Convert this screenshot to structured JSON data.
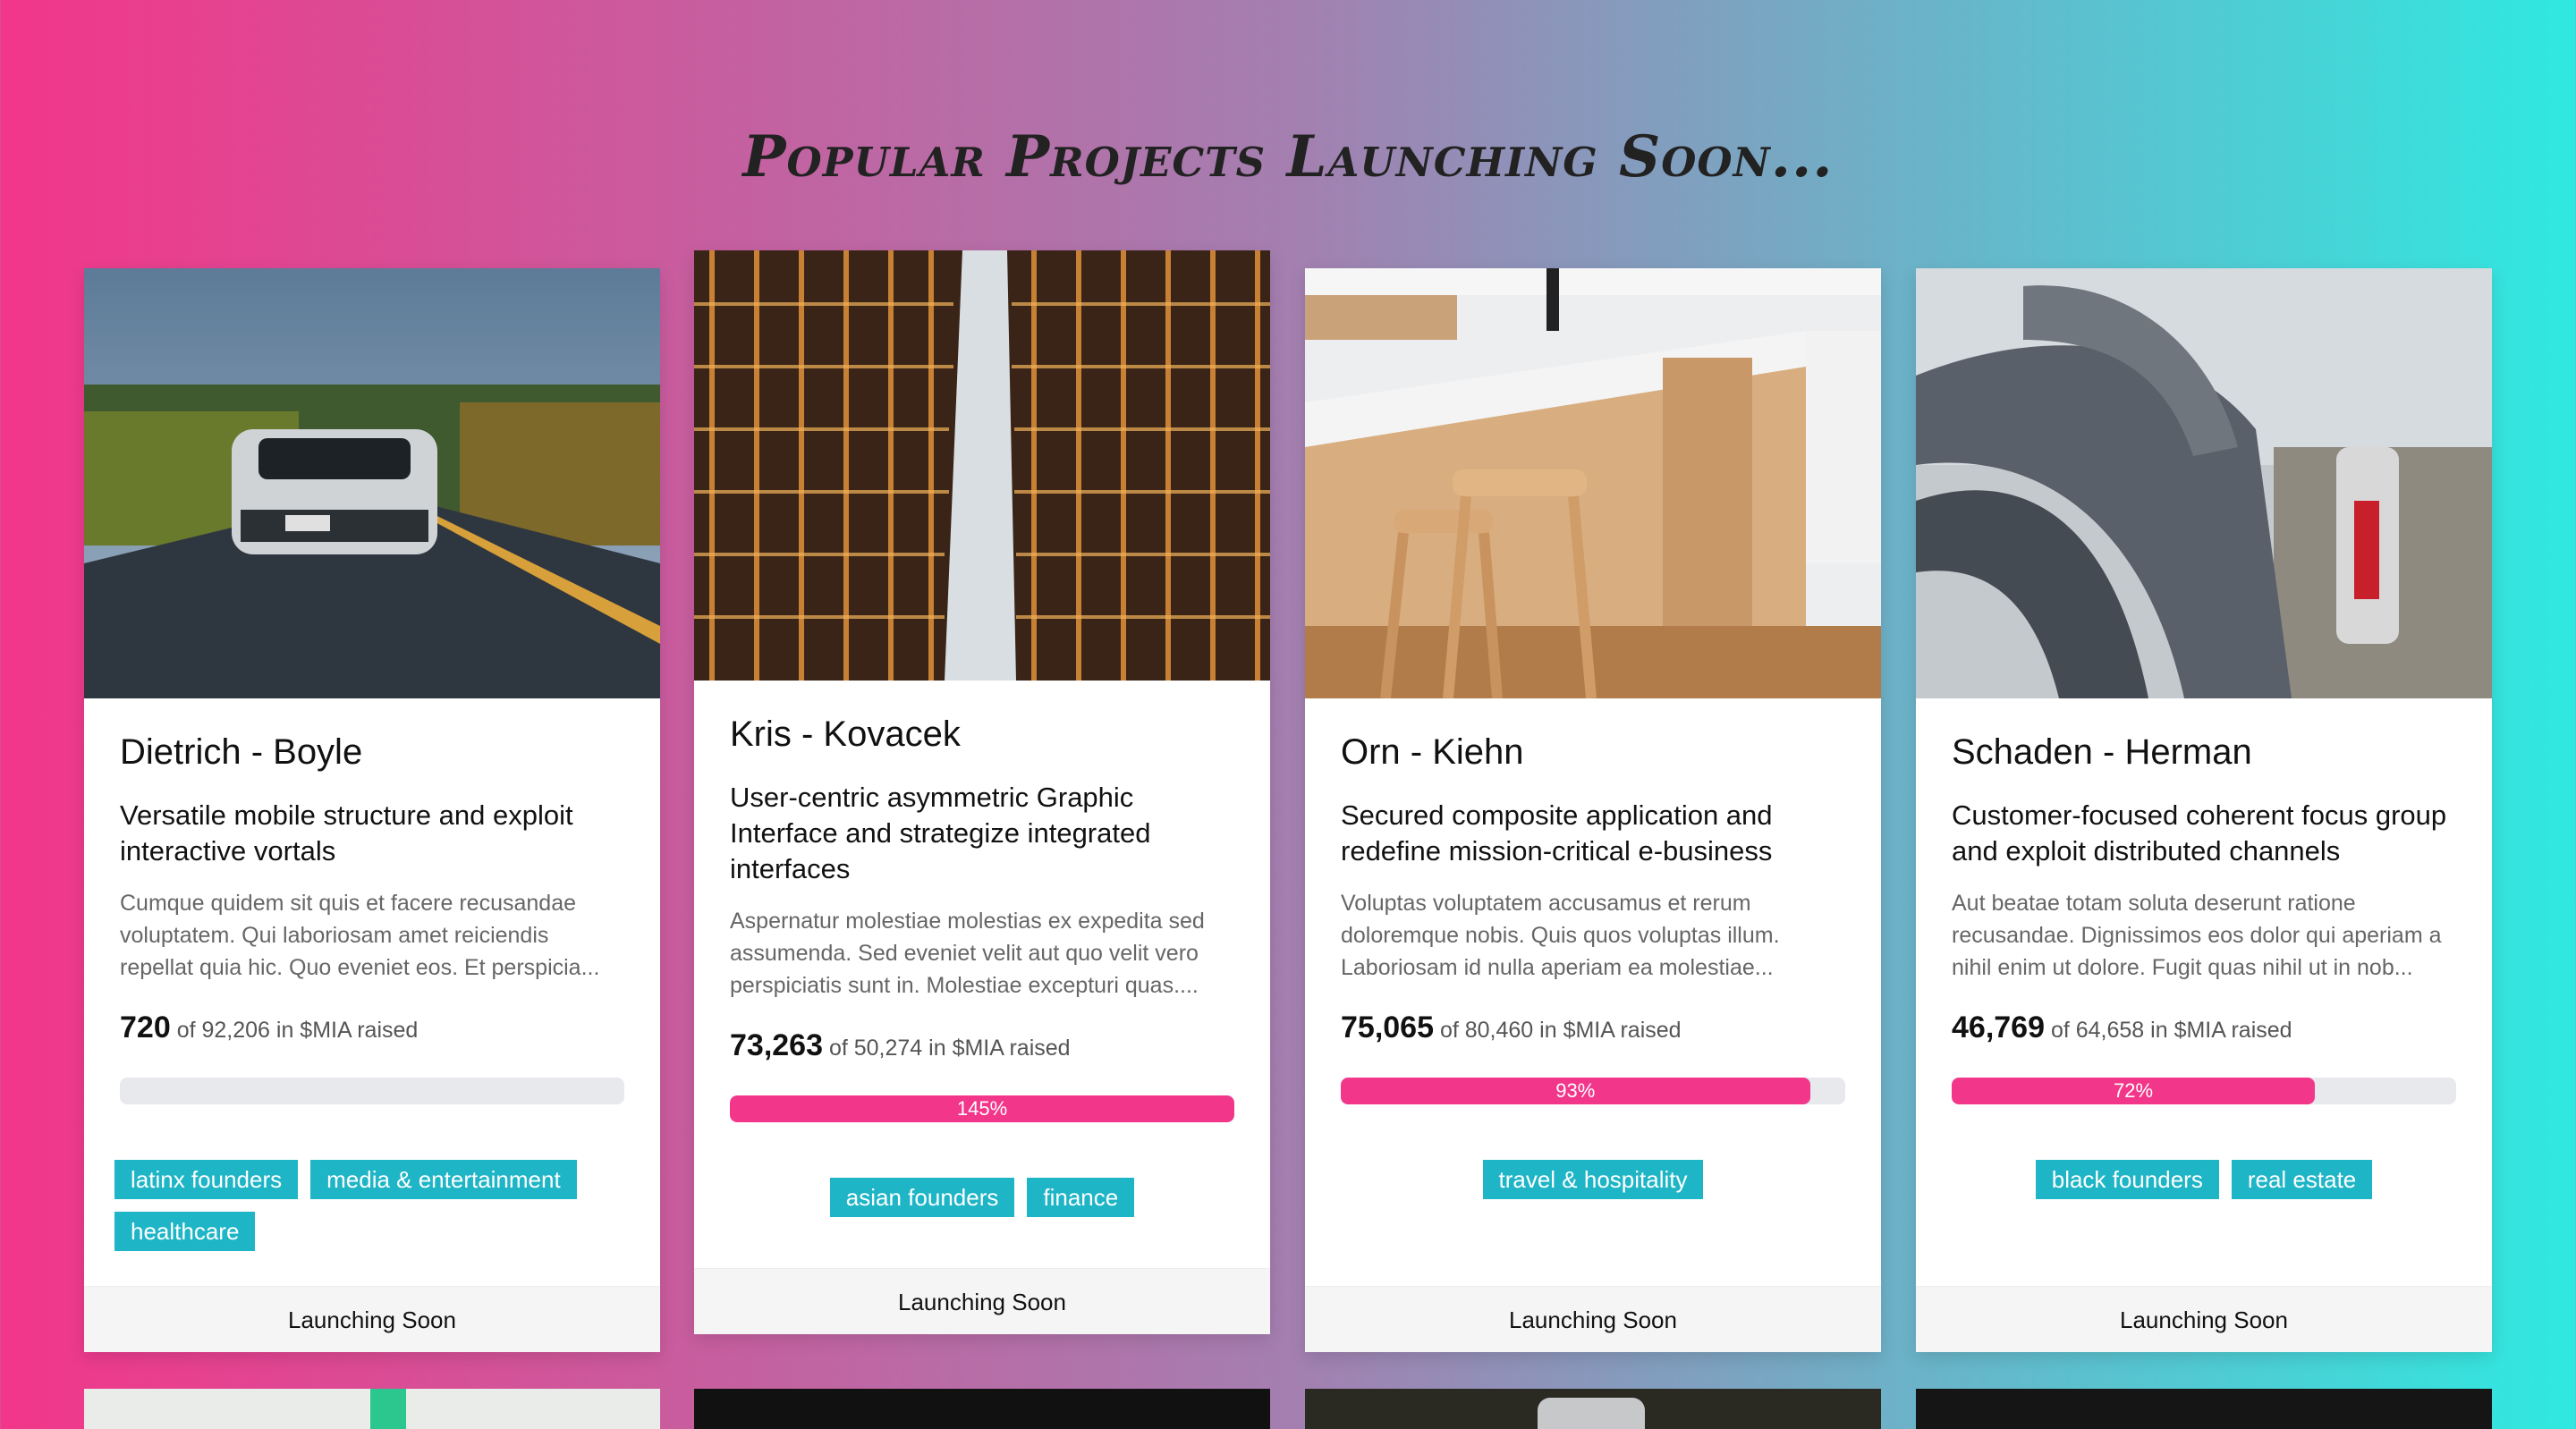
{
  "page": {
    "title": "Popular Projects Launching Soon..."
  },
  "colors": {
    "accent_pink": "#f2368a",
    "tag_teal": "#1eb5c6",
    "gradient_start": "#f2368a",
    "gradient_end": "#2fe9e1"
  },
  "cards": [
    {
      "name": "Dietrich - Boyle",
      "headline": "Versatile mobile structure and exploit interactive vortals",
      "description": "Cumque quidem sit quis et facere recusandae voluptatem. Qui laboriosam amet reiciendis repellat quia hic. Quo eveniet eos. Et perspicia...",
      "raised_amount": "720",
      "raised_text": "of 92,206 in $MIA raised",
      "progress_percent": 0,
      "progress_label": "",
      "tags": [
        "latinx founders",
        "media & entertainment",
        "healthcare"
      ],
      "footer": "Launching Soon",
      "image": "car-on-road-photo"
    },
    {
      "name": "Kris - Kovacek",
      "headline": "User-centric asymmetric Graphic Interface and strategize integrated interfaces",
      "description": "Aspernatur molestiae molestias ex expedita sed assumenda. Sed eveniet velit aut quo velit vero perspiciatis sunt in. Molestiae excepturi quas....",
      "raised_amount": "73,263",
      "raised_text": "of 50,274 in $MIA raised",
      "progress_percent": 145,
      "progress_label": "145%",
      "tags": [
        "asian founders",
        "finance"
      ],
      "footer": "Launching Soon",
      "image": "skyscrapers-photo"
    },
    {
      "name": "Orn - Kiehn",
      "headline": "Secured composite application and redefine mission-critical e-business",
      "description": "Voluptas voluptatem accusamus et rerum doloremque nobis. Quis quos voluptas illum. Laboriosam id nulla aperiam ea molestiae...",
      "raised_amount": "75,065",
      "raised_text": "of 80,460 in $MIA raised",
      "progress_percent": 93,
      "progress_label": "93%",
      "tags": [
        "travel & hospitality"
      ],
      "footer": "Launching Soon",
      "image": "kitchen-stools-photo"
    },
    {
      "name": "Schaden - Herman",
      "headline": "Customer-focused coherent focus group and exploit distributed channels",
      "description": "Aut beatae totam soluta deserunt ratione recusandae. Dignissimos eos dolor qui aperiam a nihil enim ut dolore. Fugit quas nihil ut in nob...",
      "raised_amount": "46,769",
      "raised_text": "of 64,658 in $MIA raised",
      "progress_percent": 72,
      "progress_label": "72%",
      "tags": [
        "black founders",
        "real estate"
      ],
      "footer": "Launching Soon",
      "image": "vacuum-hoses-photo"
    }
  ]
}
